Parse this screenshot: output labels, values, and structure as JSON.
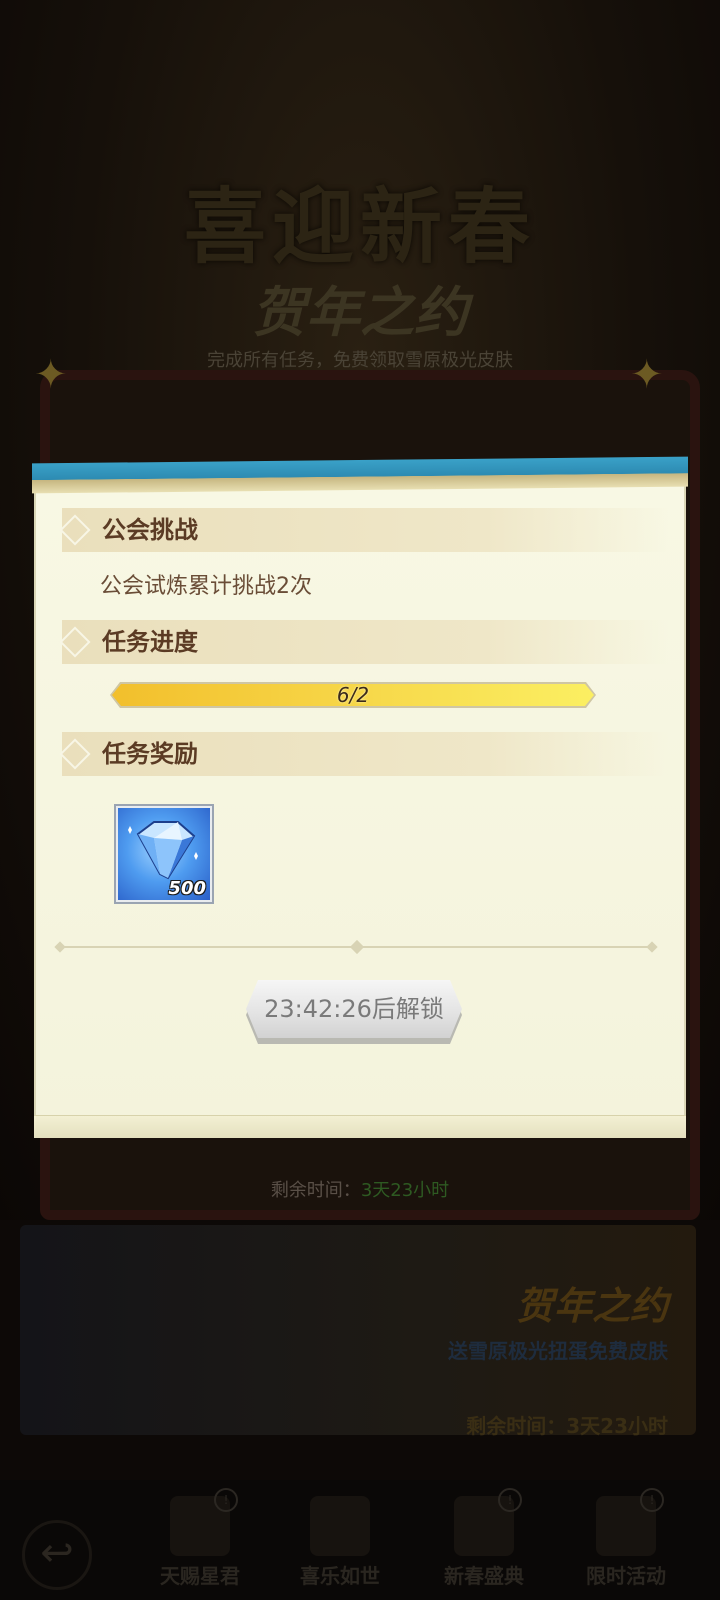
{
  "background": {
    "title": "喜迎新春",
    "subtitle": "贺年之约",
    "description": "完成所有任务，免费领取雪原极光皮肤",
    "remaining_label": "剩余时间：",
    "remaining_value": "3天23小时",
    "banner": {
      "title": "贺年之约",
      "description": "送雪原极光扭蛋免费皮肤",
      "time": "剩余时间：3天23小时"
    },
    "nav": [
      {
        "label": "天赐星君",
        "icon": "star-lord-icon",
        "badge": "!"
      },
      {
        "label": "喜乐如世",
        "icon": "city-icon",
        "badge": ""
      },
      {
        "label": "新春盛典",
        "icon": "celebration-icon",
        "badge": "!"
      },
      {
        "label": "限时活动",
        "icon": "hourglass-icon",
        "badge": "!"
      }
    ]
  },
  "dialog": {
    "section_task_title": "公会挑战",
    "task_description": "公会试炼累计挑战2次",
    "section_progress_title": "任务进度",
    "progress": {
      "text": "6/2",
      "fraction": 1.0
    },
    "section_reward_title": "任务奖励",
    "reward": {
      "icon": "diamond-icon",
      "quantity": "500"
    },
    "unlock_button_label": "23:42:26后解锁"
  },
  "colors": {
    "accent_blue": "#2d8bb2",
    "progress_yellow": "#f7d94b",
    "title_brown": "#5b3b24"
  }
}
